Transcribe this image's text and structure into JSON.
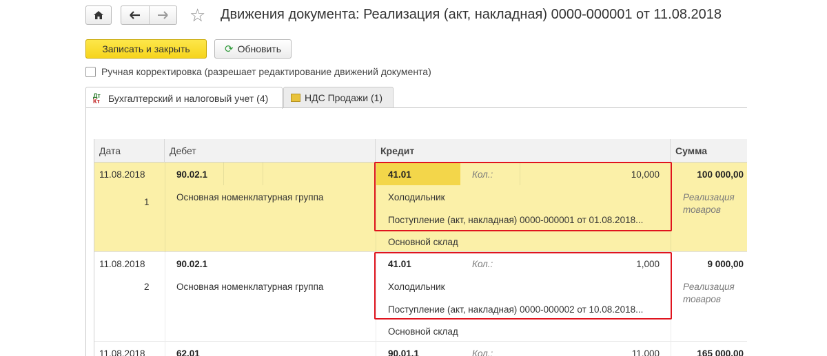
{
  "nav": {
    "home_icon": "home-icon",
    "back_icon": "arrow-left-icon",
    "forward_icon": "arrow-right-icon",
    "favorite_icon": "star-icon"
  },
  "window": {
    "title": "Движения документа: Реализация (акт, накладная) 0000-000001 от 11.08.2018"
  },
  "toolbar": {
    "save_close_label": "Записать и закрыть",
    "refresh_label": "Обновить",
    "refresh_icon": "refresh-icon"
  },
  "manual_correction": {
    "checked": false,
    "label": "Ручная корректировка (разрешает редактирование движений документа)"
  },
  "tabs": [
    {
      "label": "Бухгалтерский и налоговый учет (4)",
      "active": true,
      "icon": "dt-kt-icon",
      "icon_dt": "Дт",
      "icon_kt": "Кт"
    },
    {
      "label": "НДС Продажи (1)",
      "active": false,
      "icon": "vat-icon"
    }
  ],
  "table": {
    "columns": [
      "Дата",
      "Дебет",
      "Кредит",
      "Сумма"
    ],
    "rows": [
      {
        "date": "11.08.2018",
        "num": "1",
        "debit": "90.02.1",
        "debit_sub1": "Основная номенклатурная группа",
        "credit": "41.01",
        "qty_label": "Кол.:",
        "qty": "10,000",
        "credit_sub1": "Холодильник",
        "credit_sub2": "Поступление (акт, накладная) 0000-000001 от 01.08.2018...",
        "credit_sub3": "Основной склад",
        "sum": "100 000,00",
        "sum_note_1": "Реализация",
        "sum_note_2": "товаров"
      },
      {
        "date": "11.08.2018",
        "num": "2",
        "debit": "90.02.1",
        "debit_sub1": "Основная номенклатурная группа",
        "credit": "41.01",
        "qty_label": "Кол.:",
        "qty": "1,000",
        "credit_sub1": "Холодильник",
        "credit_sub2": "Поступление (акт, накладная) 0000-000002 от 10.08.2018...",
        "credit_sub3": "Основной склад",
        "sum": "9 000,00",
        "sum_note_1": "Реализация",
        "sum_note_2": "товаров"
      },
      {
        "date": "11.08.2018",
        "debit": "62.01",
        "credit": "90.01.1",
        "qty_label": "Кол.:",
        "qty": "11,000",
        "sum": "165 000,00"
      }
    ]
  },
  "accent": {
    "selected_row": "#fbf0a8",
    "primary_button": "#f6d41c",
    "highlight_box": "#e0141e"
  }
}
